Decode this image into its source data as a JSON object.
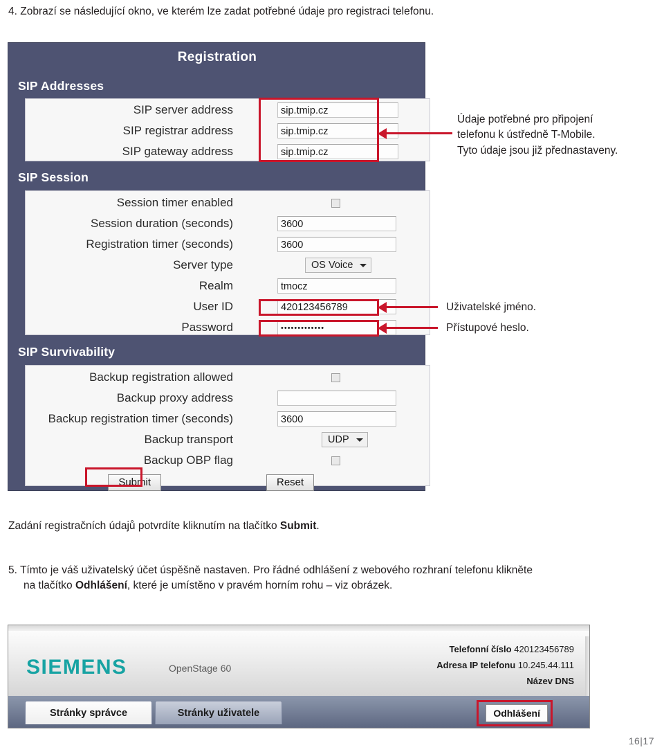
{
  "document": {
    "step4": "4. Zobrazí se následující okno, ve kterém lze zadat potřebné údaje pro registraci telefonu.",
    "caption_submit_pre": "Zadání registračních údajů potvrdíte kliknutím na tlačítko ",
    "caption_submit_bold": "Submit",
    "caption_submit_post": ".",
    "step5_pre": "5. Tímto je váš uživatelský účet úspěšně nastaven. Pro řádné odhlášení z webového rozhraní telefonu klikněte",
    "step5_indent_pre": "na tlačítko ",
    "step5_indent_bold": "Odhlášení",
    "step5_indent_post": ", které je umístěno v pravém horním rohu – viz obrázek.",
    "page_number": "16|17"
  },
  "annotations": {
    "sip_addresses_note_l1": "Údaje potřebné pro připojení",
    "sip_addresses_note_l2": "telefonu k ústředně T-Mobile.",
    "sip_addresses_note_l3": "Tyto údaje jsou již přednastaveny.",
    "user_id_note": "Uživatelské jméno.",
    "password_note": "Přístupové heslo."
  },
  "registration_panel": {
    "title": "Registration",
    "accent_color": "#4e5372",
    "highlight_color": "#c9162b",
    "sections": [
      {
        "heading": "SIP Addresses",
        "rows": [
          {
            "label": "SIP server address",
            "type": "text",
            "value": "sip.tmip.cz"
          },
          {
            "label": "SIP registrar address",
            "type": "text",
            "value": "sip.tmip.cz"
          },
          {
            "label": "SIP gateway address",
            "type": "text",
            "value": "sip.tmip.cz"
          }
        ]
      },
      {
        "heading": "SIP Session",
        "rows": [
          {
            "label": "Session timer enabled",
            "type": "checkbox",
            "value": ""
          },
          {
            "label": "Session duration (seconds)",
            "type": "text",
            "value": "3600"
          },
          {
            "label": "Registration timer (seconds)",
            "type": "text",
            "value": "3600"
          },
          {
            "label": "Server type",
            "type": "select",
            "value": "OS Voice"
          },
          {
            "label": "Realm",
            "type": "text",
            "value": "tmocz"
          },
          {
            "label": "User ID",
            "type": "text",
            "value": "420123456789"
          },
          {
            "label": "Password",
            "type": "password",
            "value": "•••••••••••••"
          }
        ]
      },
      {
        "heading": "SIP Survivability",
        "rows": [
          {
            "label": "Backup registration allowed",
            "type": "checkbox",
            "value": ""
          },
          {
            "label": "Backup proxy address",
            "type": "text",
            "value": ""
          },
          {
            "label": "Backup registration timer (seconds)",
            "type": "text",
            "value": "3600"
          },
          {
            "label": "Backup transport",
            "type": "select",
            "value": "UDP"
          },
          {
            "label": "Backup OBP flag",
            "type": "checkbox",
            "value": ""
          }
        ],
        "buttons": {
          "submit": "Submit",
          "reset": "Reset"
        }
      }
    ]
  },
  "phone_header": {
    "brand": "SIEMENS",
    "model": "OpenStage 60",
    "info": [
      {
        "key": "Telefonní číslo",
        "value": "420123456789"
      },
      {
        "key": "Adresa IP telefonu",
        "value": "10.245.44.111"
      },
      {
        "key": "Název DNS",
        "value": ""
      }
    ],
    "tabs": [
      {
        "label": "Stránky správce",
        "active": true
      },
      {
        "label": "Stránky uživatele",
        "active": false
      }
    ],
    "logout_label": "Odhlášení"
  }
}
